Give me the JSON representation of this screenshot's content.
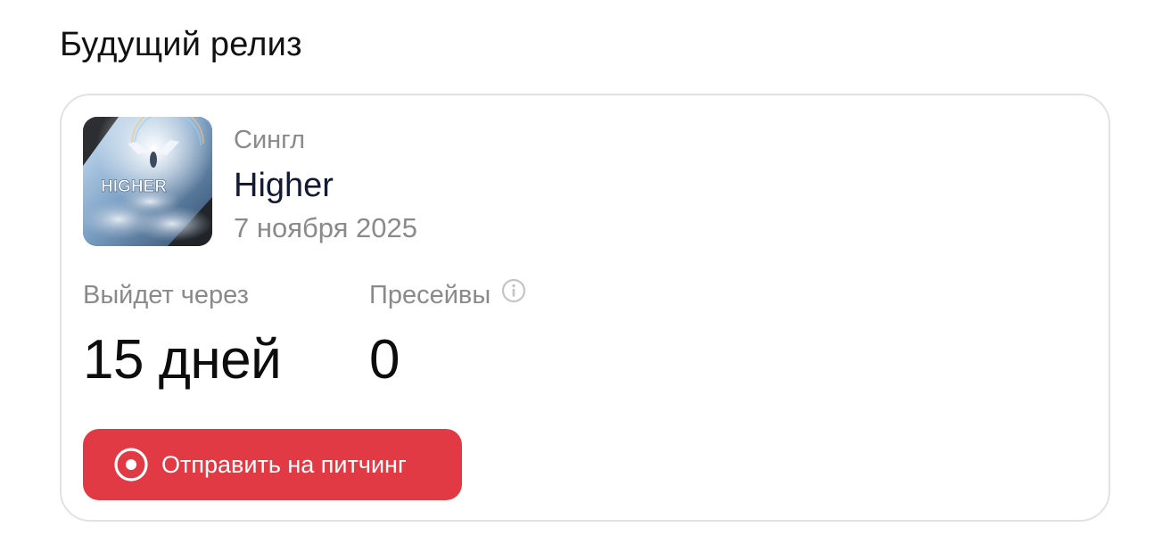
{
  "section": {
    "title": "Будущий релиз"
  },
  "release": {
    "cover_alt": "Обложка релиза",
    "cover_text": "HIGHER",
    "type": "Сингл",
    "title": "Higher",
    "date": "7 ноября 2025"
  },
  "stats": {
    "release_in": {
      "label": "Выйдет через",
      "value": "15 дней"
    },
    "presaves": {
      "label": "Пресейвы",
      "value": "0",
      "info_icon": "info-circle-icon"
    }
  },
  "actions": {
    "pitch_button_label": "Отправить на питчинг",
    "pitch_button_icon": "target-icon"
  },
  "colors": {
    "accent": "#e23a45",
    "muted_text": "#8a8a8a",
    "title_text": "#141a33",
    "card_border": "#e2e2e2"
  }
}
